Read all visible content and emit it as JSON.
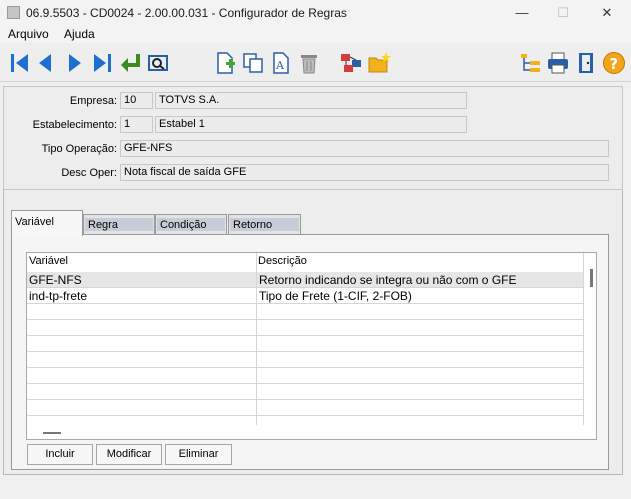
{
  "window": {
    "title": "06.9.5503 - CD0024 - 2.00.00.031 - Configurador de Regras",
    "minimize": "—",
    "maximize": "☐",
    "close": "✕"
  },
  "menu": [
    "Arquivo",
    "Ajuda"
  ],
  "toolbar": {
    "icons": [
      "first-icon",
      "prev-icon",
      "next-icon",
      "last-icon",
      "goto-icon",
      "search-icon",
      "new-icon",
      "copy-icon",
      "edit-icon",
      "delete-icon",
      "network-icon",
      "folder-new-icon",
      "tree-icon",
      "print-icon",
      "exit-icon",
      "help-icon"
    ]
  },
  "form": {
    "empresa": {
      "label": "Empresa:",
      "code": "10",
      "name": "TOTVS S.A."
    },
    "estabelecimento": {
      "label": "Estabelecimento:",
      "code": "1",
      "name": "Estabel 1"
    },
    "tipo_operacao": {
      "label": "Tipo Operação:",
      "value": "GFE-NFS"
    },
    "desc_oper": {
      "label": "Desc Oper:",
      "value": "Nota fiscal de saída GFE"
    }
  },
  "tabs": [
    "Variável",
    "Regra",
    "Condição",
    "Retorno"
  ],
  "grid": {
    "columns": [
      "Variável",
      "Descrição"
    ],
    "rows": [
      {
        "variavel": "GFE-NFS",
        "descricao": "Retorno indicando se integra ou não com o GFE"
      },
      {
        "variavel": "ind-tp-frete",
        "descricao": "Tipo de Frete (1-CIF, 2-FOB)"
      }
    ]
  },
  "buttons": {
    "incluir": "Incluir",
    "modificar": "Modificar",
    "eliminar": "Eliminar"
  }
}
